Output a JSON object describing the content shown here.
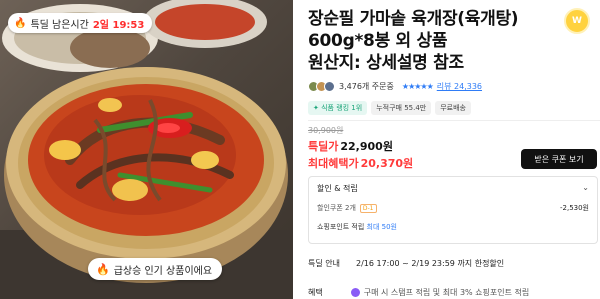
{
  "photo": {
    "timer_label": "특딜 남은시간",
    "timer_value": "2일 19:53",
    "popular_label": "급상승 인기 상품이에요"
  },
  "product": {
    "title_lines": [
      "장순필 가마솥 육개장(육개탕)",
      "600g*8봉 외 상품",
      "원산지: 상세설명 참조"
    ],
    "wish_icon_label": "W"
  },
  "meta": {
    "buyers": "3,476개 주문중",
    "stars": "★★★★★",
    "reviews": "리뷰 24,336"
  },
  "badges": {
    "rank": "✦ 식품 랭킹 1위",
    "sold": "누적구매 55.4만",
    "delivery": "무료배송"
  },
  "price": {
    "original": "30,900원",
    "sale_label": "특딜가",
    "sale_value": "22,900원",
    "max_label": "최대혜택가",
    "max_value": "20,370원",
    "coupon_button": "받은 쿠폰 보기"
  },
  "discount": {
    "title": "할인 & 적립",
    "coupon_label": "할인쿠폰 2개",
    "coupon_tag": "D-1",
    "coupon_amount": "-2,530원",
    "points_label": "쇼핑포인트 적립",
    "points_value": "최대 50원"
  },
  "sale_info": {
    "label": "특딜 안내",
    "period": "2/16 17:00 ~ 2/19 23:59 까지 한정할인"
  },
  "benefit": {
    "label": "혜택",
    "text": "구매 시 스탬프 적립 및 최대 3% 쇼핑포인트 적립"
  },
  "colors": {
    "accent_red": "#ff3b3b",
    "link_blue": "#2f7cf6",
    "rank_green": "#1da57a",
    "wish_yellow": "#ffd23f"
  }
}
